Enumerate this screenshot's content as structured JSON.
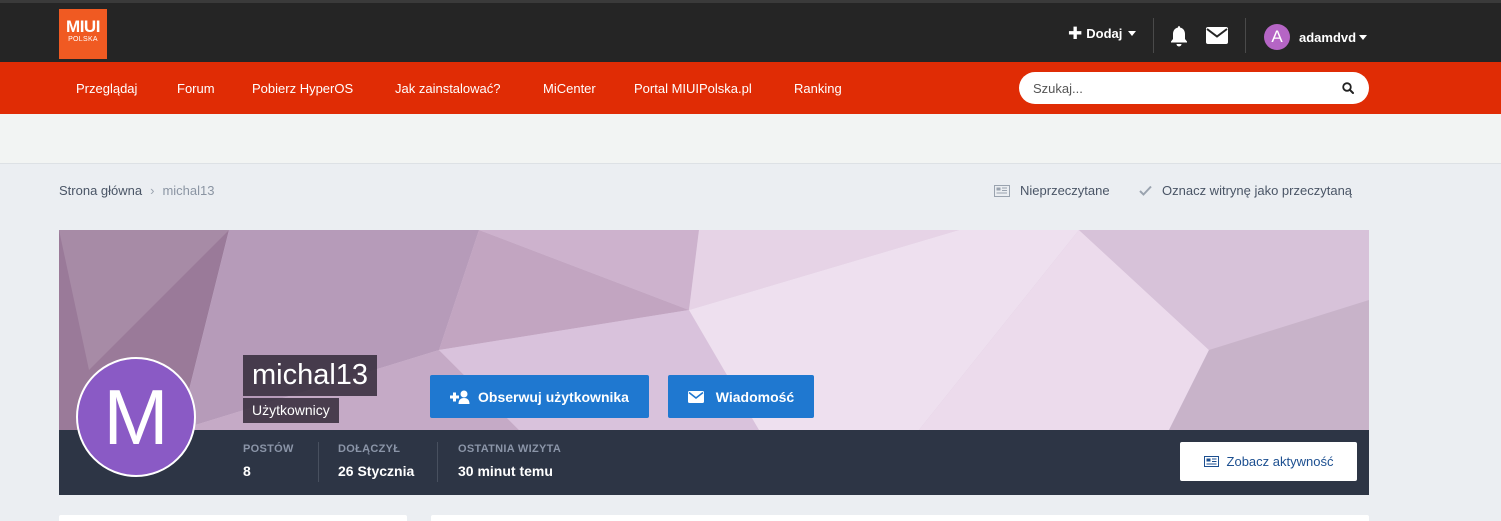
{
  "header": {
    "logo": {
      "line1": "MIUI",
      "line2": "POLSKA"
    },
    "add_label": "Dodaj",
    "user": {
      "initial": "A",
      "name": "adamdvd"
    }
  },
  "nav": {
    "items": [
      "Przeglądaj",
      "Forum",
      "Pobierz HyperOS",
      "Jak zainstalować?",
      "MiCenter",
      "Portal MIUIPolska.pl",
      "Ranking"
    ],
    "search_placeholder": "Szukaj..."
  },
  "breadcrumb": {
    "home": "Strona główna",
    "current": "michal13"
  },
  "page_actions": {
    "unread": "Nieprzeczytane",
    "mark_read": "Oznacz witrynę jako przeczytaną"
  },
  "profile": {
    "avatar_letter": "M",
    "username": "michal13",
    "group": "Użytkownicy",
    "follow_button": "Obserwuj użytkownika",
    "message_button": "Wiadomość",
    "stats": [
      {
        "label": "POSTÓW",
        "value": "8"
      },
      {
        "label": "DOŁĄCZYŁ",
        "value": "26 Stycznia"
      },
      {
        "label": "OSTATNIA WIZYTA",
        "value": "30 minut temu"
      }
    ],
    "activity_button": "Zobacz aktywność"
  },
  "colors": {
    "accent": "#e02c05",
    "button": "#1f78d0",
    "avatar": "#8a5ac5",
    "topbar": "#252525",
    "infobar": "#2d3545"
  }
}
